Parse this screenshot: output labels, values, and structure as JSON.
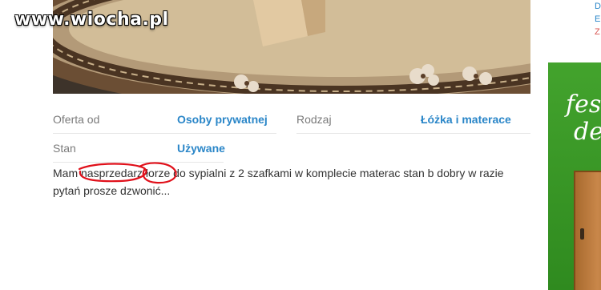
{
  "watermark": "www.wiocha.pl",
  "params": [
    {
      "label": "Oferta od",
      "value": "Osoby prywatnej"
    },
    {
      "label": "Rodzaj",
      "value": "Łóżka i materace"
    },
    {
      "label": "Stan",
      "value": "Używane"
    }
  ],
  "description": "Mam nasprzedarz łorze do sypialni z 2 szafkami w komplecie materac stan b dobry w razie pytań prosze dzwonić...",
  "sidebar": {
    "links": [
      "D",
      "E",
      "Z"
    ],
    "banner_text": [
      "fes",
      "de"
    ]
  },
  "colors": {
    "link": "#2a86c8",
    "annotation": "#e0101a",
    "banner": "#3a9a26"
  }
}
